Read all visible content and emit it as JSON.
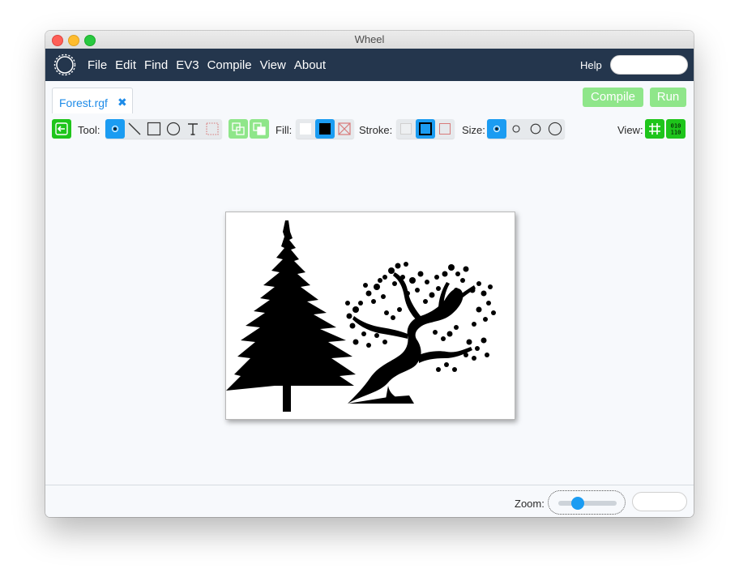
{
  "window": {
    "title": "Wheel"
  },
  "menubar": {
    "items": [
      "File",
      "Edit",
      "Find",
      "EV3",
      "Compile",
      "View",
      "About"
    ],
    "help_label": "Help",
    "help_value": ""
  },
  "tabs": [
    {
      "label": "Forest.rgf",
      "close_icon": "close-icon"
    }
  ],
  "actions": {
    "compile_label": "Compile",
    "run_label": "Run"
  },
  "toolbar": {
    "tool_label": "Tool:",
    "tools": [
      "pencil",
      "line",
      "rectangle",
      "circle",
      "text",
      "select"
    ],
    "selected_tool": "pencil",
    "fill_label": "Fill:",
    "fill_options": [
      "white",
      "black",
      "none"
    ],
    "selected_fill": "black",
    "stroke_label": "Stroke:",
    "stroke_options": [
      "white",
      "black",
      "none"
    ],
    "selected_stroke": "black",
    "size_label": "Size:",
    "size_options": [
      "1",
      "2",
      "3",
      "4"
    ],
    "selected_size": "1",
    "view_label": "View:",
    "binary_icon_text": [
      "010",
      "110"
    ]
  },
  "status": {
    "zoom_label": "Zoom:",
    "zoom_value": ""
  },
  "colors": {
    "menubar": "#24364d",
    "accent": "#1b9cf2",
    "green": "#1ec51b",
    "light_green": "#8fe68a"
  }
}
